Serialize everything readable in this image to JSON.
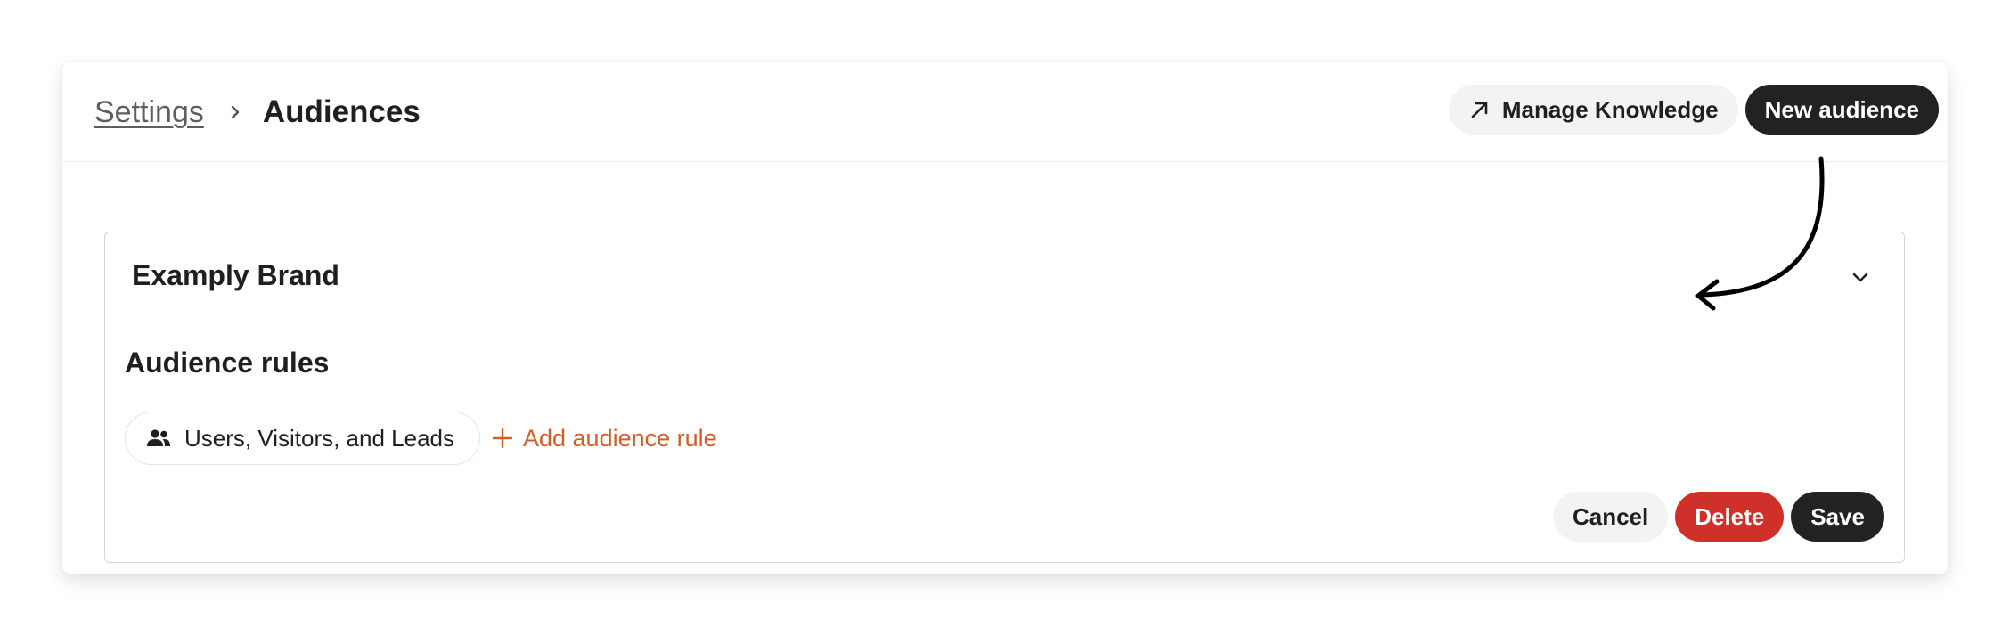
{
  "header": {
    "breadcrumb_parent": "Settings",
    "breadcrumb_current": "Audiences",
    "manage_knowledge_label": "Manage Knowledge",
    "new_audience_label": "New audience"
  },
  "card": {
    "title": "Examply Brand",
    "section_title": "Audience rules",
    "rule_chip_label": "Users, Visitors, and Leads",
    "add_rule_label": "Add audience rule",
    "cancel_label": "Cancel",
    "delete_label": "Delete",
    "save_label": "Save"
  },
  "icons": {
    "breadcrumb_separator": "chevron-right-icon",
    "manage_knowledge": "arrow-up-right-icon",
    "card_toggle": "chevron-down-icon",
    "rule_chip": "people-icon",
    "add_rule": "plus-icon"
  },
  "colors": {
    "primary_button": "#222222",
    "danger_button": "#d0302a",
    "accent_link": "#d25d26",
    "secondary_button": "#f3f3f3"
  }
}
